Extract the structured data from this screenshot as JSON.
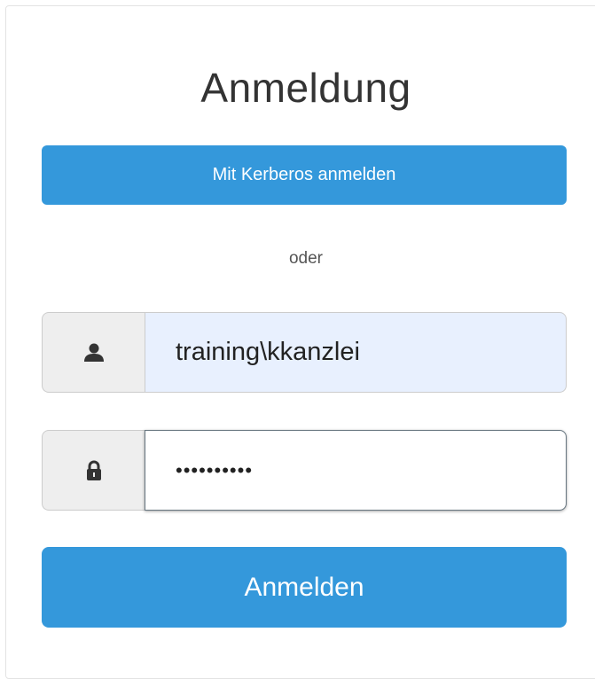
{
  "login": {
    "title": "Anmeldung",
    "kerberos_label": "Mit Kerberos anmelden",
    "separator": "oder",
    "username": {
      "icon": "user-icon",
      "value": "training\\kkanzlei"
    },
    "password": {
      "icon": "lock-icon",
      "value": "••••••••••"
    },
    "submit_label": "Anmelden"
  },
  "colors": {
    "primary_button": "#3498db",
    "autofill_background": "#e8f0fe",
    "addon_background": "#eeeeee"
  }
}
